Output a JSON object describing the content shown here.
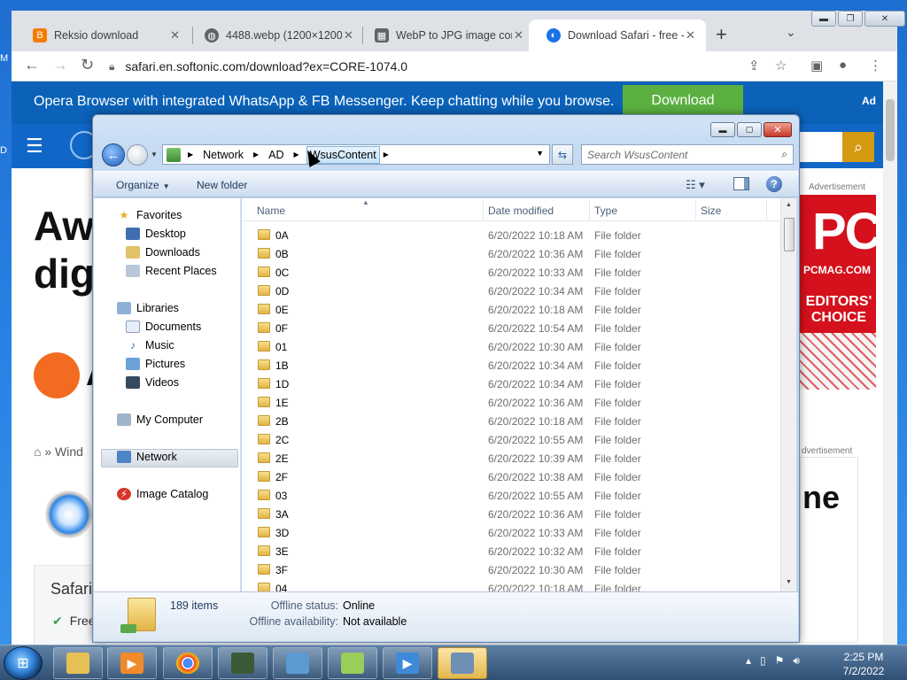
{
  "desktop": {
    "left_letters": [
      "M",
      "D"
    ]
  },
  "browser": {
    "tabs": [
      {
        "title": "Reksio download",
        "icon": "blogger-icon",
        "color": "#f57c00"
      },
      {
        "title": "4488.webp (1200×1200)",
        "icon": "globe-icon",
        "color": "#5f6368"
      },
      {
        "title": "WebP to JPG image con",
        "icon": "image-convert-icon",
        "color": "#5f6368"
      },
      {
        "title": "Download Safari - free -",
        "icon": "softonic-icon",
        "color": "#1a73e8",
        "active": true
      }
    ],
    "url": "safari.en.softonic.com/download?ex=CORE-1074.0",
    "window_buttons": [
      "minimize",
      "restore",
      "close"
    ]
  },
  "webpage": {
    "promo_text": "Opera Browser with integrated WhatsApp & FB Messenger. Keep chatting while you browse.",
    "promo_button": "Download",
    "promo_ad": "Ad",
    "headline_1": "Aw",
    "headline_2": "dig",
    "brand_letter": "A",
    "breadcrumb": "Wind",
    "card_title": "Safari",
    "card_feature": "Free",
    "ad_label_1": "Advertisement",
    "ad_label_2": "dvertisement",
    "pcmag": {
      "logo": "PC",
      "sub": "PCMAG.COM",
      "award": "EDITORS' CHOICE"
    },
    "ad2_text": "ne",
    "colors": {
      "promo": "#0b62b8",
      "nav": "#1167c8",
      "download": "#5bb040",
      "search": "#d39a12",
      "brand": "#f26b21",
      "pcmag": "#d4111c"
    }
  },
  "explorer": {
    "breadcrumb": [
      "Network",
      "AD",
      "WsusContent"
    ],
    "search_placeholder": "Search WsusContent",
    "commands": {
      "organize": "Organize",
      "new_folder": "New folder"
    },
    "nav": {
      "favorites": {
        "label": "Favorites",
        "items": [
          "Desktop",
          "Downloads",
          "Recent Places"
        ]
      },
      "libraries": {
        "label": "Libraries",
        "items": [
          "Documents",
          "Music",
          "Pictures",
          "Videos"
        ]
      },
      "computer": "My Computer",
      "network": "Network",
      "catalog": "Image Catalog"
    },
    "columns": [
      "Name",
      "Date modified",
      "Type",
      "Size"
    ],
    "rows": [
      {
        "name": "0A",
        "date": "6/20/2022 10:18 AM",
        "type": "File folder"
      },
      {
        "name": "0B",
        "date": "6/20/2022 10:36 AM",
        "type": "File folder"
      },
      {
        "name": "0C",
        "date": "6/20/2022 10:33 AM",
        "type": "File folder"
      },
      {
        "name": "0D",
        "date": "6/20/2022 10:34 AM",
        "type": "File folder"
      },
      {
        "name": "0E",
        "date": "6/20/2022 10:18 AM",
        "type": "File folder"
      },
      {
        "name": "0F",
        "date": "6/20/2022 10:54 AM",
        "type": "File folder"
      },
      {
        "name": "01",
        "date": "6/20/2022 10:30 AM",
        "type": "File folder"
      },
      {
        "name": "1B",
        "date": "6/20/2022 10:34 AM",
        "type": "File folder"
      },
      {
        "name": "1D",
        "date": "6/20/2022 10:34 AM",
        "type": "File folder"
      },
      {
        "name": "1E",
        "date": "6/20/2022 10:36 AM",
        "type": "File folder"
      },
      {
        "name": "2B",
        "date": "6/20/2022 10:18 AM",
        "type": "File folder"
      },
      {
        "name": "2C",
        "date": "6/20/2022 10:55 AM",
        "type": "File folder"
      },
      {
        "name": "2E",
        "date": "6/20/2022 10:39 AM",
        "type": "File folder"
      },
      {
        "name": "2F",
        "date": "6/20/2022 10:38 AM",
        "type": "File folder"
      },
      {
        "name": "03",
        "date": "6/20/2022 10:55 AM",
        "type": "File folder"
      },
      {
        "name": "3A",
        "date": "6/20/2022 10:36 AM",
        "type": "File folder"
      },
      {
        "name": "3D",
        "date": "6/20/2022 10:33 AM",
        "type": "File folder"
      },
      {
        "name": "3E",
        "date": "6/20/2022 10:32 AM",
        "type": "File folder"
      },
      {
        "name": "3F",
        "date": "6/20/2022 10:30 AM",
        "type": "File folder"
      },
      {
        "name": "04",
        "date": "6/20/2022 10:18 AM",
        "type": "File folder"
      }
    ],
    "details": {
      "count": "189 items",
      "offline_status_label": "Offline status:",
      "offline_status": "Online",
      "offline_avail_label": "Offline availability:",
      "offline_avail": "Not available"
    }
  },
  "taskbar": {
    "apps": [
      "explorer-icon",
      "media-player-icon",
      "chrome-icon",
      "task-manager-icon",
      "image-viewer-icon",
      "notepad-chart-icon",
      "video-icon",
      "network-file-icon"
    ],
    "time": "2:25 PM",
    "date": "7/2/2022"
  }
}
